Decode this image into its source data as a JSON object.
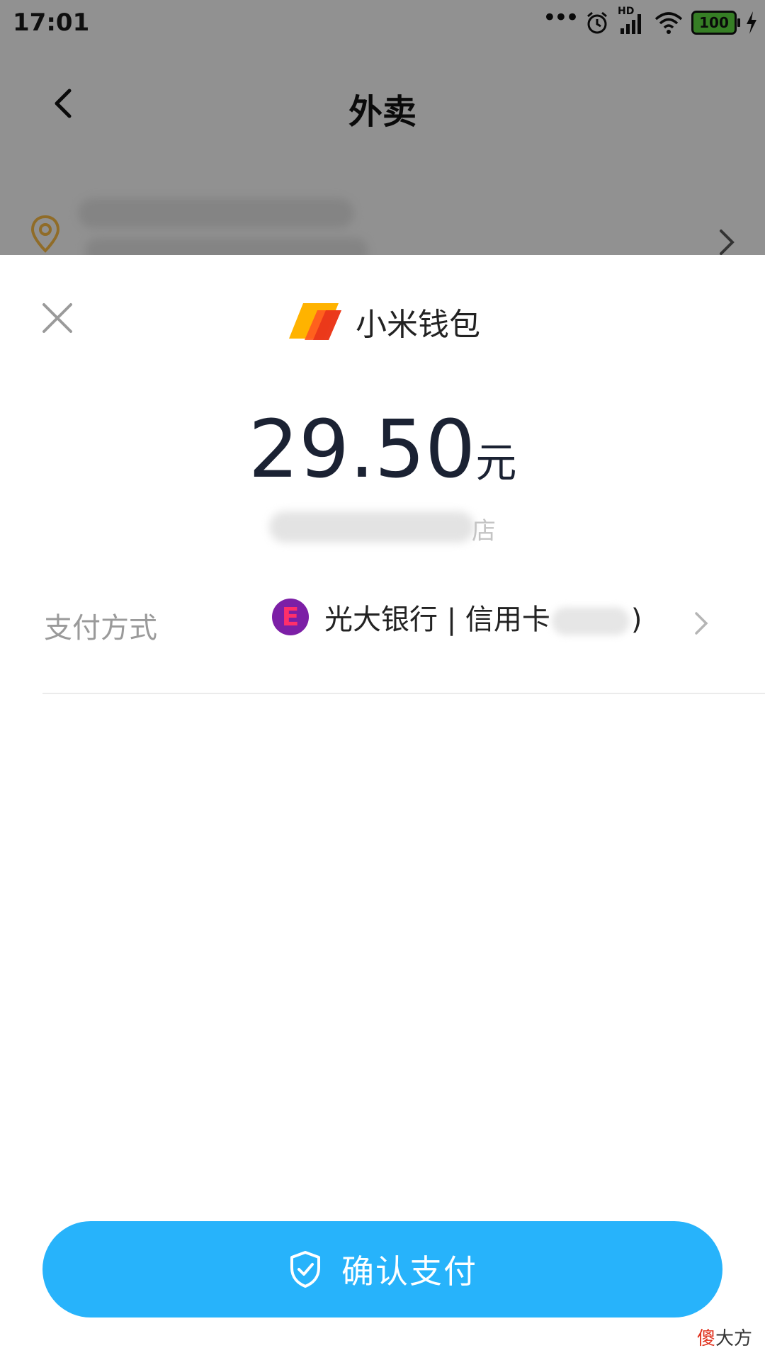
{
  "status_bar": {
    "time": "17:01",
    "network": "HD",
    "battery": "100"
  },
  "header": {
    "title": "外卖"
  },
  "sheet": {
    "wallet_name": "小米钱包",
    "amount": "29.50",
    "currency_unit": "元",
    "merchant_suffix": "店",
    "payment_label": "支付方式",
    "bank_icon_letter": "E",
    "payment_method": "光大银行 | 信用卡",
    "card_suffix_close": ")",
    "confirm_label": "确认支付"
  },
  "watermark": {
    "prefix": "傻",
    "rest": "大方"
  },
  "colors": {
    "accent": "#27b3fb",
    "amount_text": "#1b2233",
    "label_gray": "#9a9a9a"
  },
  "icons": [
    "back-arrow-icon",
    "location-pin-icon",
    "close-icon",
    "xiaomi-wallet-logo-icon",
    "bank-logo-icon",
    "chevron-right-icon",
    "shield-check-icon"
  ]
}
